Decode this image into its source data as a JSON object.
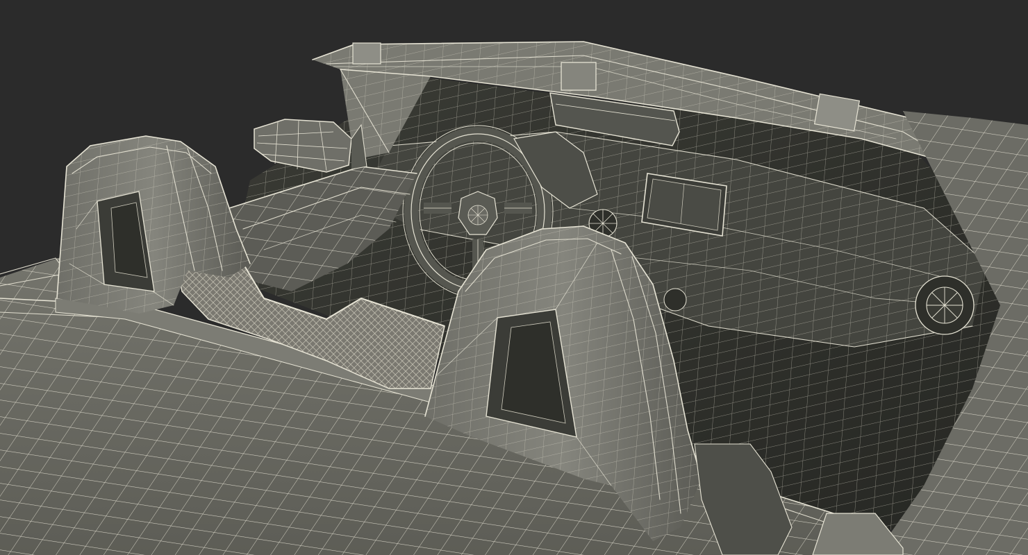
{
  "scene": {
    "subject": "convertible-car-wireframe-render",
    "render_style": "wireframe-on-shaded",
    "background_color": "#2b2b2b",
    "shade_colors": {
      "body_panel": "#6a6a63",
      "body_panel_light": "#7c7c74",
      "interior_dark": "#2f302c",
      "interior_mid": "#3e3f39",
      "wire": "#e6e3d4",
      "mesh_screen": "#b4b1a3"
    },
    "components": [
      "rear-deck",
      "left-rollbar",
      "right-rollbar",
      "wind-deflector-mesh",
      "windshield-frame",
      "rearview-mirror",
      "side-mirror",
      "dashboard",
      "steering-wheel",
      "center-display",
      "air-vent",
      "door-panel"
    ]
  }
}
